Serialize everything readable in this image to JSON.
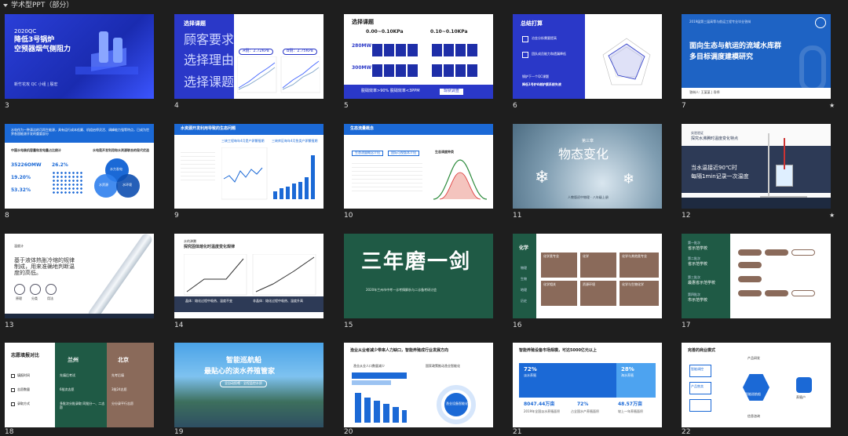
{
  "title": "学术型PPT（部分）",
  "slides": [
    {
      "num": "3"
    },
    {
      "num": "4"
    },
    {
      "num": "5"
    },
    {
      "num": "6"
    },
    {
      "num": "7",
      "star": "★"
    },
    {
      "num": "8"
    },
    {
      "num": "9"
    },
    {
      "num": "10"
    },
    {
      "num": "11"
    },
    {
      "num": "12",
      "star": "★"
    },
    {
      "num": "13"
    },
    {
      "num": "14"
    },
    {
      "num": "15"
    },
    {
      "num": "16"
    },
    {
      "num": "17"
    },
    {
      "num": "18"
    },
    {
      "num": "19"
    },
    {
      "num": "20"
    },
    {
      "num": "21"
    },
    {
      "num": "22"
    }
  ],
  "s3": {
    "year": "2020QC",
    "line1": "降低3号锅炉",
    "line2": "空预器烟气侧阻力",
    "footer": "新竹花攻 QC 小组 | 殷宏"
  },
  "s4": {
    "title": "选择课题",
    "h1": "顾客要求",
    "h2": "选择理由",
    "h3": "选择课题",
    "pill1": "A侧：2.72KPa",
    "pill2": "B侧：2.75KPa"
  },
  "s5": {
    "title": "选择课题",
    "col1": "0.00~0.10KPa",
    "col2": "0.10~0.10KPa",
    "row1": "280MW",
    "row2": "300MW",
    "foot": "脱硝效率>90%  脱硝效率<3PPM",
    "btn": "现状调查"
  },
  "s6": {
    "title": "总结打算",
    "r1": "冶金分析需要提高",
    "r2": "团队成员能力和遗漏降低",
    "r3": "锅炉下一个QC课题",
    "r4": "降低1号炉A侧炉膜系统失液"
  },
  "s7": {
    "top": "2019届第三届高等与航运工程专业毕业答辩",
    "line1": "面向生态与航运的流域水库群",
    "line2": "多目标调度建模研究",
    "foot": "答辩人: 王某某  |  导师"
  },
  "s8": {
    "head": "水电作为一种清洁的可再生能源，具有运行成本低廉、机组启停灵活、调峰能力强等特点，已成为世界各国能源开发的重要部分",
    "lt": "中国水电装机容量和发电量占比统计",
    "v1": "35226OMW",
    "v2": "26.2%",
    "v3": "19.20%",
    "v4": "53.32%",
    "rt": "水电是开发利用和水资源联合的现代优选",
    "c1": "水力发电",
    "c2": "水资源",
    "c3": "水环境"
  },
  "s9": {
    "title": "水资源开发利用导致的生态问题",
    "a": "三峡工程每年4月是产卵繁殖期",
    "b": "三峡库区每年4月鱼类产卵繁殖期"
  },
  "s10": {
    "title": "生态流量概念",
    "a": "生态流量概念介绍",
    "b": "国际可视版本介绍",
    "c": "生态调度种类"
  },
  "s11": {
    "pre": "第三章",
    "title": "物态变化",
    "sub": "人教版初中物理 · 八年级上册"
  },
  "s12": {
    "tag": "实验验证",
    "h1": "探究水沸腾时温度变化特点",
    "line1": "当水温接近90℃时",
    "line2": "每隔1min记录一次温度"
  },
  "s13": {
    "pre": "温度计",
    "text": "基于液体热胀冷缩的规律制成，用来准确地判断温度的高低。",
    "i1": "原理",
    "i2": "分类",
    "i3": "用法"
  },
  "s14": {
    "pre": "水的沸腾",
    "title": "探究固体熔化时温度变化规律",
    "c1": "晶体：熔化过程中吸热、温度不变",
    "c2": "非晶体：熔化过程中吸热、温度升高"
  },
  "s15": {
    "title": "三年磨一剑",
    "sub": "2020年兰州市中考一诊考情解析与二诊备考研讨会"
  },
  "s16": {
    "side": "化学",
    "s1": "物理",
    "s2": "生物",
    "s3": "地理",
    "s4": "历史",
    "c1": "化学类专业",
    "c2": "化学",
    "c3": "化学与其他类专业",
    "c4": "化学相关",
    "c5": "资源环境",
    "c6": "化学与生物化学"
  },
  "s17": {
    "g1": "第一批次",
    "a": "省示范学校",
    "g2": "第二批次",
    "b": "省示范学校",
    "g3": "第三批次",
    "c": "最惠省示范学校",
    "g4": "第四批次",
    "d": "市示范学校"
  },
  "s18": {
    "title": "志愿填报对比",
    "c1": "兰州",
    "c2": "北京",
    "r1": "填报时间",
    "r2": "志愿数量",
    "r3": "录取方式",
    "a1": "先填后考试",
    "a2": "6批次志愿",
    "a3": "多批次分批录取 同批分一、二志愿",
    "b1": "先考后填",
    "b2": "3批24志愿",
    "b3": "分分录平行志愿"
  },
  "s19": {
    "line1": "智能巡航船",
    "line2": "最贴心的淡水养殖管家",
    "sub": "全自动投喂 · 全程监控水质"
  },
  "s20": {
    "title": "渔业从业者减少带来人力缺口，智能养殖成行业发展方向",
    "l": "渔业从业人口数量减少",
    "r": "国家政策推动渔业智能化",
    "center": "渔业设备智能化"
  },
  "s21": {
    "title": "智能养殖设备市场规模，可达5000亿元以上",
    "p1": "72%",
    "p2": "28%",
    "l1": "淡水养殖",
    "l2": "海水养殖",
    "v1": "8047.44万亩",
    "v2": "72%",
    "v3": "48.57万亩",
    "d1": "2019年全国淡水养殖面积",
    "d2": "占全国水产养殖面积",
    "d3": "较上一年养殖面积"
  },
  "s22": {
    "title": "完善的商业模式",
    "top": "产品研发",
    "bot": "信息咨询",
    "center": "智能巡航船",
    "right": "养殖户",
    "left1": "智能调控",
    "left2": "产品售卖"
  }
}
